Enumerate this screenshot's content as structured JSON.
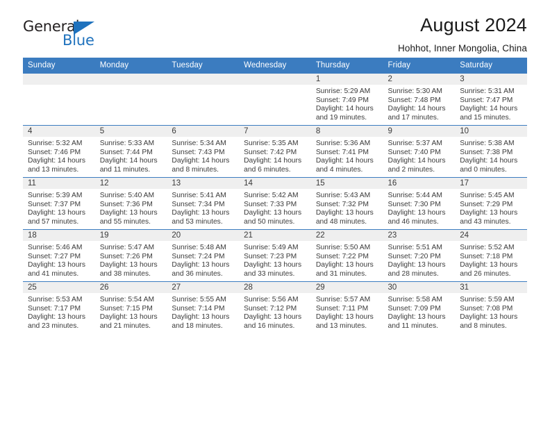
{
  "brand": {
    "name_top": "General",
    "name_bottom": "Blue",
    "accent_color": "#1f72bd"
  },
  "header": {
    "title": "August 2024",
    "subtitle": "Hohhot, Inner Mongolia, China"
  },
  "calendar": {
    "header_color": "#3b7cc0",
    "weekdays": [
      "Sunday",
      "Monday",
      "Tuesday",
      "Wednesday",
      "Thursday",
      "Friday",
      "Saturday"
    ],
    "leading_blanks": 4,
    "days": [
      {
        "num": "1",
        "sunrise": "Sunrise: 5:29 AM",
        "sunset": "Sunset: 7:49 PM",
        "daylight_1": "Daylight: 14 hours",
        "daylight_2": "and 19 minutes."
      },
      {
        "num": "2",
        "sunrise": "Sunrise: 5:30 AM",
        "sunset": "Sunset: 7:48 PM",
        "daylight_1": "Daylight: 14 hours",
        "daylight_2": "and 17 minutes."
      },
      {
        "num": "3",
        "sunrise": "Sunrise: 5:31 AM",
        "sunset": "Sunset: 7:47 PM",
        "daylight_1": "Daylight: 14 hours",
        "daylight_2": "and 15 minutes."
      },
      {
        "num": "4",
        "sunrise": "Sunrise: 5:32 AM",
        "sunset": "Sunset: 7:46 PM",
        "daylight_1": "Daylight: 14 hours",
        "daylight_2": "and 13 minutes."
      },
      {
        "num": "5",
        "sunrise": "Sunrise: 5:33 AM",
        "sunset": "Sunset: 7:44 PM",
        "daylight_1": "Daylight: 14 hours",
        "daylight_2": "and 11 minutes."
      },
      {
        "num": "6",
        "sunrise": "Sunrise: 5:34 AM",
        "sunset": "Sunset: 7:43 PM",
        "daylight_1": "Daylight: 14 hours",
        "daylight_2": "and 8 minutes."
      },
      {
        "num": "7",
        "sunrise": "Sunrise: 5:35 AM",
        "sunset": "Sunset: 7:42 PM",
        "daylight_1": "Daylight: 14 hours",
        "daylight_2": "and 6 minutes."
      },
      {
        "num": "8",
        "sunrise": "Sunrise: 5:36 AM",
        "sunset": "Sunset: 7:41 PM",
        "daylight_1": "Daylight: 14 hours",
        "daylight_2": "and 4 minutes."
      },
      {
        "num": "9",
        "sunrise": "Sunrise: 5:37 AM",
        "sunset": "Sunset: 7:40 PM",
        "daylight_1": "Daylight: 14 hours",
        "daylight_2": "and 2 minutes."
      },
      {
        "num": "10",
        "sunrise": "Sunrise: 5:38 AM",
        "sunset": "Sunset: 7:38 PM",
        "daylight_1": "Daylight: 14 hours",
        "daylight_2": "and 0 minutes."
      },
      {
        "num": "11",
        "sunrise": "Sunrise: 5:39 AM",
        "sunset": "Sunset: 7:37 PM",
        "daylight_1": "Daylight: 13 hours",
        "daylight_2": "and 57 minutes."
      },
      {
        "num": "12",
        "sunrise": "Sunrise: 5:40 AM",
        "sunset": "Sunset: 7:36 PM",
        "daylight_1": "Daylight: 13 hours",
        "daylight_2": "and 55 minutes."
      },
      {
        "num": "13",
        "sunrise": "Sunrise: 5:41 AM",
        "sunset": "Sunset: 7:34 PM",
        "daylight_1": "Daylight: 13 hours",
        "daylight_2": "and 53 minutes."
      },
      {
        "num": "14",
        "sunrise": "Sunrise: 5:42 AM",
        "sunset": "Sunset: 7:33 PM",
        "daylight_1": "Daylight: 13 hours",
        "daylight_2": "and 50 minutes."
      },
      {
        "num": "15",
        "sunrise": "Sunrise: 5:43 AM",
        "sunset": "Sunset: 7:32 PM",
        "daylight_1": "Daylight: 13 hours",
        "daylight_2": "and 48 minutes."
      },
      {
        "num": "16",
        "sunrise": "Sunrise: 5:44 AM",
        "sunset": "Sunset: 7:30 PM",
        "daylight_1": "Daylight: 13 hours",
        "daylight_2": "and 46 minutes."
      },
      {
        "num": "17",
        "sunrise": "Sunrise: 5:45 AM",
        "sunset": "Sunset: 7:29 PM",
        "daylight_1": "Daylight: 13 hours",
        "daylight_2": "and 43 minutes."
      },
      {
        "num": "18",
        "sunrise": "Sunrise: 5:46 AM",
        "sunset": "Sunset: 7:27 PM",
        "daylight_1": "Daylight: 13 hours",
        "daylight_2": "and 41 minutes."
      },
      {
        "num": "19",
        "sunrise": "Sunrise: 5:47 AM",
        "sunset": "Sunset: 7:26 PM",
        "daylight_1": "Daylight: 13 hours",
        "daylight_2": "and 38 minutes."
      },
      {
        "num": "20",
        "sunrise": "Sunrise: 5:48 AM",
        "sunset": "Sunset: 7:24 PM",
        "daylight_1": "Daylight: 13 hours",
        "daylight_2": "and 36 minutes."
      },
      {
        "num": "21",
        "sunrise": "Sunrise: 5:49 AM",
        "sunset": "Sunset: 7:23 PM",
        "daylight_1": "Daylight: 13 hours",
        "daylight_2": "and 33 minutes."
      },
      {
        "num": "22",
        "sunrise": "Sunrise: 5:50 AM",
        "sunset": "Sunset: 7:22 PM",
        "daylight_1": "Daylight: 13 hours",
        "daylight_2": "and 31 minutes."
      },
      {
        "num": "23",
        "sunrise": "Sunrise: 5:51 AM",
        "sunset": "Sunset: 7:20 PM",
        "daylight_1": "Daylight: 13 hours",
        "daylight_2": "and 28 minutes."
      },
      {
        "num": "24",
        "sunrise": "Sunrise: 5:52 AM",
        "sunset": "Sunset: 7:18 PM",
        "daylight_1": "Daylight: 13 hours",
        "daylight_2": "and 26 minutes."
      },
      {
        "num": "25",
        "sunrise": "Sunrise: 5:53 AM",
        "sunset": "Sunset: 7:17 PM",
        "daylight_1": "Daylight: 13 hours",
        "daylight_2": "and 23 minutes."
      },
      {
        "num": "26",
        "sunrise": "Sunrise: 5:54 AM",
        "sunset": "Sunset: 7:15 PM",
        "daylight_1": "Daylight: 13 hours",
        "daylight_2": "and 21 minutes."
      },
      {
        "num": "27",
        "sunrise": "Sunrise: 5:55 AM",
        "sunset": "Sunset: 7:14 PM",
        "daylight_1": "Daylight: 13 hours",
        "daylight_2": "and 18 minutes."
      },
      {
        "num": "28",
        "sunrise": "Sunrise: 5:56 AM",
        "sunset": "Sunset: 7:12 PM",
        "daylight_1": "Daylight: 13 hours",
        "daylight_2": "and 16 minutes."
      },
      {
        "num": "29",
        "sunrise": "Sunrise: 5:57 AM",
        "sunset": "Sunset: 7:11 PM",
        "daylight_1": "Daylight: 13 hours",
        "daylight_2": "and 13 minutes."
      },
      {
        "num": "30",
        "sunrise": "Sunrise: 5:58 AM",
        "sunset": "Sunset: 7:09 PM",
        "daylight_1": "Daylight: 13 hours",
        "daylight_2": "and 11 minutes."
      },
      {
        "num": "31",
        "sunrise": "Sunrise: 5:59 AM",
        "sunset": "Sunset: 7:08 PM",
        "daylight_1": "Daylight: 13 hours",
        "daylight_2": "and 8 minutes."
      }
    ]
  }
}
